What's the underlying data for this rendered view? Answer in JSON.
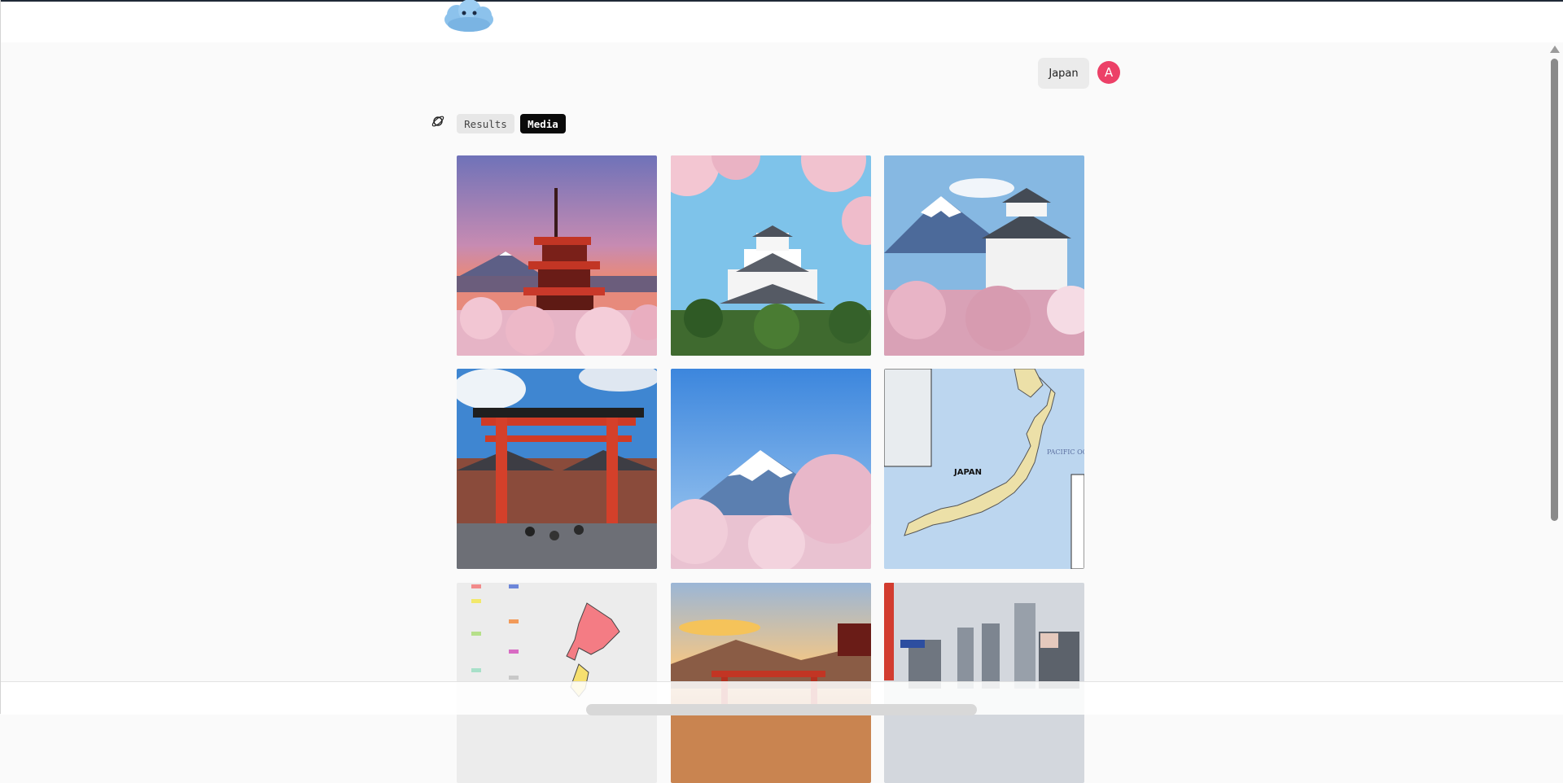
{
  "header": {
    "logo_icon": "cloud-face-logo"
  },
  "query": {
    "chip_label": "Japan"
  },
  "user": {
    "avatar_initial": "A",
    "avatar_color": "#ec4067"
  },
  "tabs": [
    {
      "label": "Results",
      "active": false
    },
    {
      "label": "Media",
      "active": true
    }
  ],
  "tabs_icon": "orbit-icon",
  "map_tile": {
    "country_label": "JAPAN",
    "ocean_label": "PACIFIC OCEAN"
  }
}
